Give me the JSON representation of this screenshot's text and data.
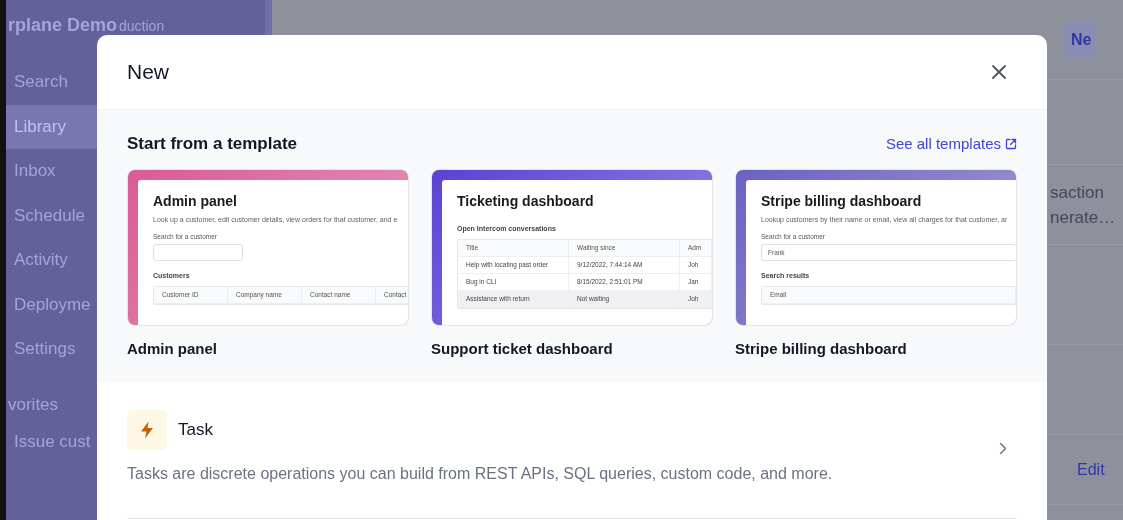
{
  "sidebar": {
    "workspace": "rplane Demo",
    "environment": "duction",
    "items": [
      {
        "label": "Search",
        "selected": false
      },
      {
        "label": "Library",
        "selected": true
      },
      {
        "label": "Inbox",
        "selected": false
      },
      {
        "label": "Schedule",
        "selected": false
      },
      {
        "label": "Activity",
        "selected": false
      },
      {
        "label": "Deployme",
        "selected": false
      },
      {
        "label": "Settings",
        "selected": false
      }
    ],
    "section_title": "vorites",
    "favorites": [
      {
        "label": "Issue cust"
      }
    ]
  },
  "main": {
    "new_button": "Ne",
    "row_text": [
      "saction",
      "nerate…"
    ],
    "edit_link": "Edit"
  },
  "modal": {
    "title": "New",
    "template_section": {
      "heading": "Start from a template",
      "link": "See all templates",
      "templates": [
        {
          "name": "Admin panel",
          "color": "#d95b95",
          "preview": {
            "title": "Admin panel",
            "description": "Look up a customer, edit customer details, view orders for that customer, and e",
            "blocks": [
              {
                "kind": "label",
                "text": "Search for a customer"
              },
              {
                "kind": "field"
              },
              {
                "kind": "heading",
                "text": "Customers"
              },
              {
                "kind": "table",
                "columns": [
                  "Customer ID",
                  "Company name",
                  "Contact name",
                  "Contact"
                ]
              }
            ]
          }
        },
        {
          "name": "Support ticket dashboard",
          "color": "#5a42d4",
          "preview": {
            "title": "Ticketing dashboard",
            "blocks": [
              {
                "kind": "heading",
                "text": "Open Intercom conversations"
              },
              {
                "kind": "table",
                "columns": [
                  "Title",
                  "Waiting since",
                  "Adm"
                ],
                "rows": [
                  {
                    "cells": [
                      "Help with locating past order",
                      "9/12/2022, 7:44:14 AM",
                      "Joh"
                    ],
                    "selected": false
                  },
                  {
                    "cells": [
                      "Bug in CLI",
                      "8/15/2022, 2:51:01 PM",
                      "Jan"
                    ],
                    "selected": false
                  },
                  {
                    "cells": [
                      "Assistance with return",
                      "Not waiting",
                      "Joh"
                    ],
                    "selected": true
                  }
                ]
              }
            ]
          }
        },
        {
          "name": "Stripe billing dashboard",
          "color": "#6a62c0",
          "preview": {
            "title": "Stripe billing dashboard",
            "description": "Lookup customers by their name or email, view all charges for that customer, ar",
            "blocks": [
              {
                "kind": "label",
                "text": "Search for a customer"
              },
              {
                "kind": "field",
                "value": "Frank"
              },
              {
                "kind": "heading",
                "text": "Search results"
              },
              {
                "kind": "table",
                "columns": [
                  "Email"
                ]
              }
            ]
          }
        }
      ]
    },
    "options": [
      {
        "title": "Task",
        "description": "Tasks are discrete operations you can build from REST APIs, SQL queries, custom code, and more."
      }
    ]
  }
}
